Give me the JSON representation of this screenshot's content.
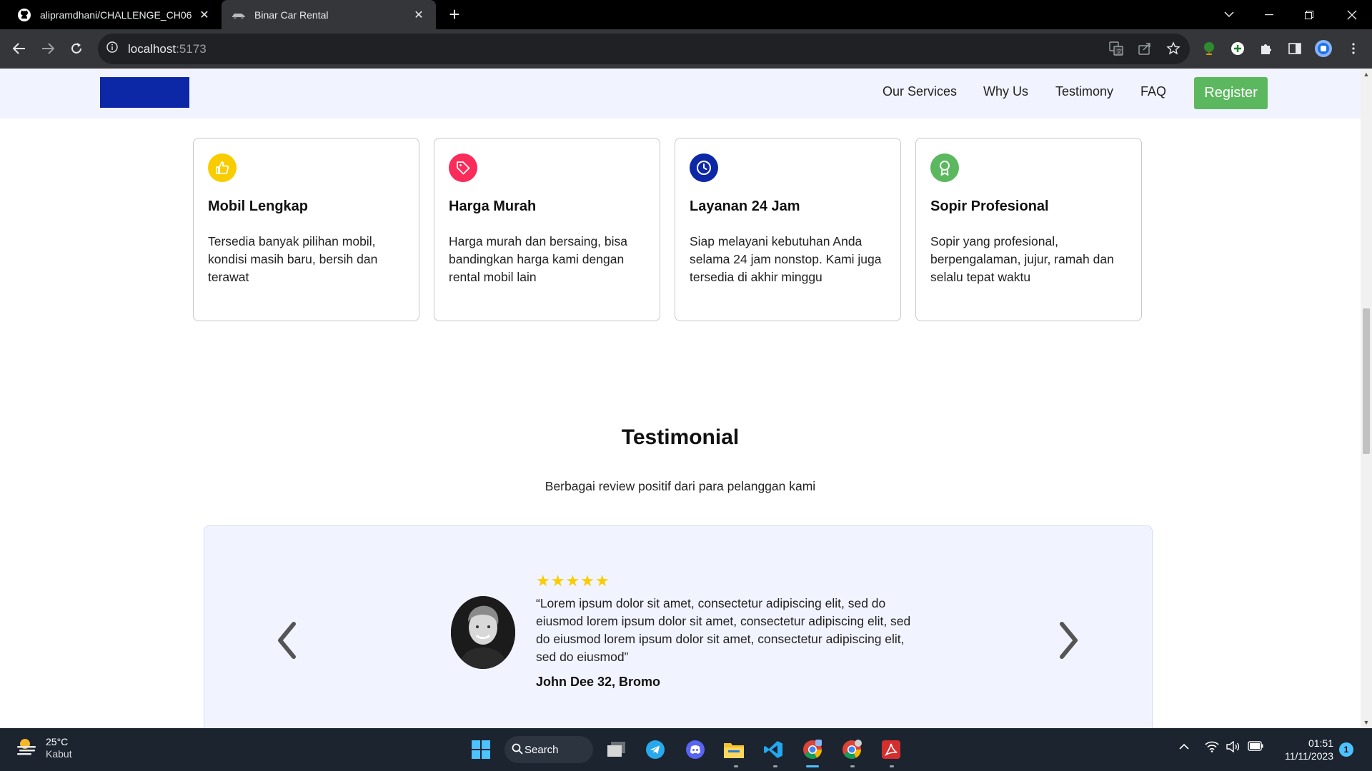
{
  "browser": {
    "tabs": [
      {
        "title": "alipramdhani/CHALLENGE_CH06",
        "icon": "github-icon"
      },
      {
        "title": "Binar Car Rental",
        "icon": "car-icon"
      }
    ],
    "url_host": "localhost",
    "url_port": ":5173"
  },
  "nav": {
    "links": [
      "Our Services",
      "Why Us",
      "Testimony",
      "FAQ"
    ],
    "register_label": "Register",
    "logo_color": "#0d28a6"
  },
  "why_us": {
    "cards": [
      {
        "icon": "thumbs-up-icon",
        "color": "#f9cc00",
        "title": "Mobil Lengkap",
        "text": "Tersedia banyak pilihan mobil, kondisi masih baru, bersih dan terawat"
      },
      {
        "icon": "price-tag-icon",
        "color": "#fa2c5a",
        "title": "Harga Murah",
        "text": "Harga murah dan bersaing, bisa bandingkan harga kami dengan rental mobil lain"
      },
      {
        "icon": "clock-icon",
        "color": "#0d28a6",
        "title": "Layanan 24 Jam",
        "text": "Siap melayani kebutuhan Anda selama 24 jam nonstop. Kami juga tersedia di akhir minggu"
      },
      {
        "icon": "award-icon",
        "color": "#5cb85f",
        "title": "Sopir Profesional",
        "text": "Sopir yang profesional, berpengalaman, jujur, ramah dan selalu tepat waktu"
      }
    ]
  },
  "testimonial": {
    "title": "Testimonial",
    "subtitle": "Berbagai review positif dari para pelanggan kami",
    "stars": "★★★★★",
    "rating": 5,
    "quote": "“Lorem ipsum dolor sit amet, consectetur adipiscing elit, sed do eiusmod lorem ipsum dolor sit amet, consectetur adipiscing elit, sed do eiusmod lorem ipsum dolor sit amet, consectetur adipiscing elit, sed do eiusmod”",
    "author": "John Dee 32, Bromo"
  },
  "taskbar": {
    "temperature": "25°C",
    "condition": "Kabut",
    "search_label": "Search",
    "time": "01:51",
    "date": "11/11/2023",
    "notifications": "1"
  }
}
